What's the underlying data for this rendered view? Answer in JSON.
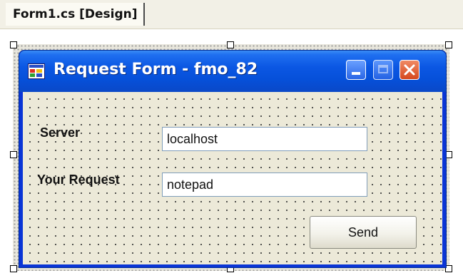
{
  "designer": {
    "tab_label": "Form1.cs [Design]"
  },
  "form": {
    "title": "Request Form - fmo_82",
    "icon": "form-icon",
    "caption_buttons": [
      "minimize",
      "maximize",
      "close"
    ],
    "titlebar_color": "#0b57e3",
    "close_button_color": "#d6481e"
  },
  "controls": {
    "server_label": "Server",
    "server_value": "localhost",
    "request_label": "Your Request",
    "request_value": "notepad",
    "send_label": "Send"
  }
}
